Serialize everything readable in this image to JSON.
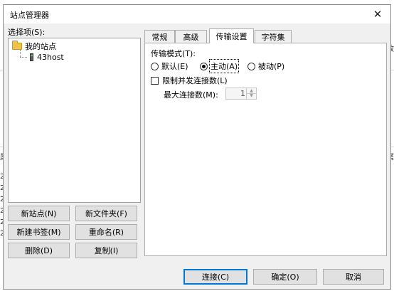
{
  "dialog": {
    "title": "站点管理器",
    "close_glyph": "✕"
  },
  "left": {
    "select_label": "选择项(S):",
    "tree": {
      "root_label": "我的站点",
      "children": [
        "43host"
      ]
    },
    "buttons": {
      "new_site": "新站点(N)",
      "new_folder": "新文件夹(F)",
      "new_bookmark": "新建书签(M)",
      "rename": "重命名(R)",
      "delete": "删除(D)",
      "copy": "复制(I)"
    }
  },
  "tabs": [
    {
      "label": "常规",
      "active": false
    },
    {
      "label": "高级",
      "active": false
    },
    {
      "label": "传输设置",
      "active": true
    },
    {
      "label": "字符集",
      "active": false
    }
  ],
  "transfer": {
    "mode_label": "传输模式(T):",
    "modes": [
      {
        "label": "默认(E)",
        "selected": false
      },
      {
        "label": "主动(A)",
        "selected": true
      },
      {
        "label": "被动(P)",
        "selected": false
      }
    ],
    "limit_label": "限制并发连接数(L)",
    "limit_checked": false,
    "max_label": "最大连接数(M):",
    "max_value": "1"
  },
  "footer": {
    "connect": "连接(C)",
    "ok": "确定(O)",
    "cancel": "取消"
  },
  "background_fragments": {
    "left": [
      "属",
      "20",
      "20",
      "20",
      "20",
      "20",
      "20"
    ],
    "right": [
      "改",
      "属"
    ]
  }
}
